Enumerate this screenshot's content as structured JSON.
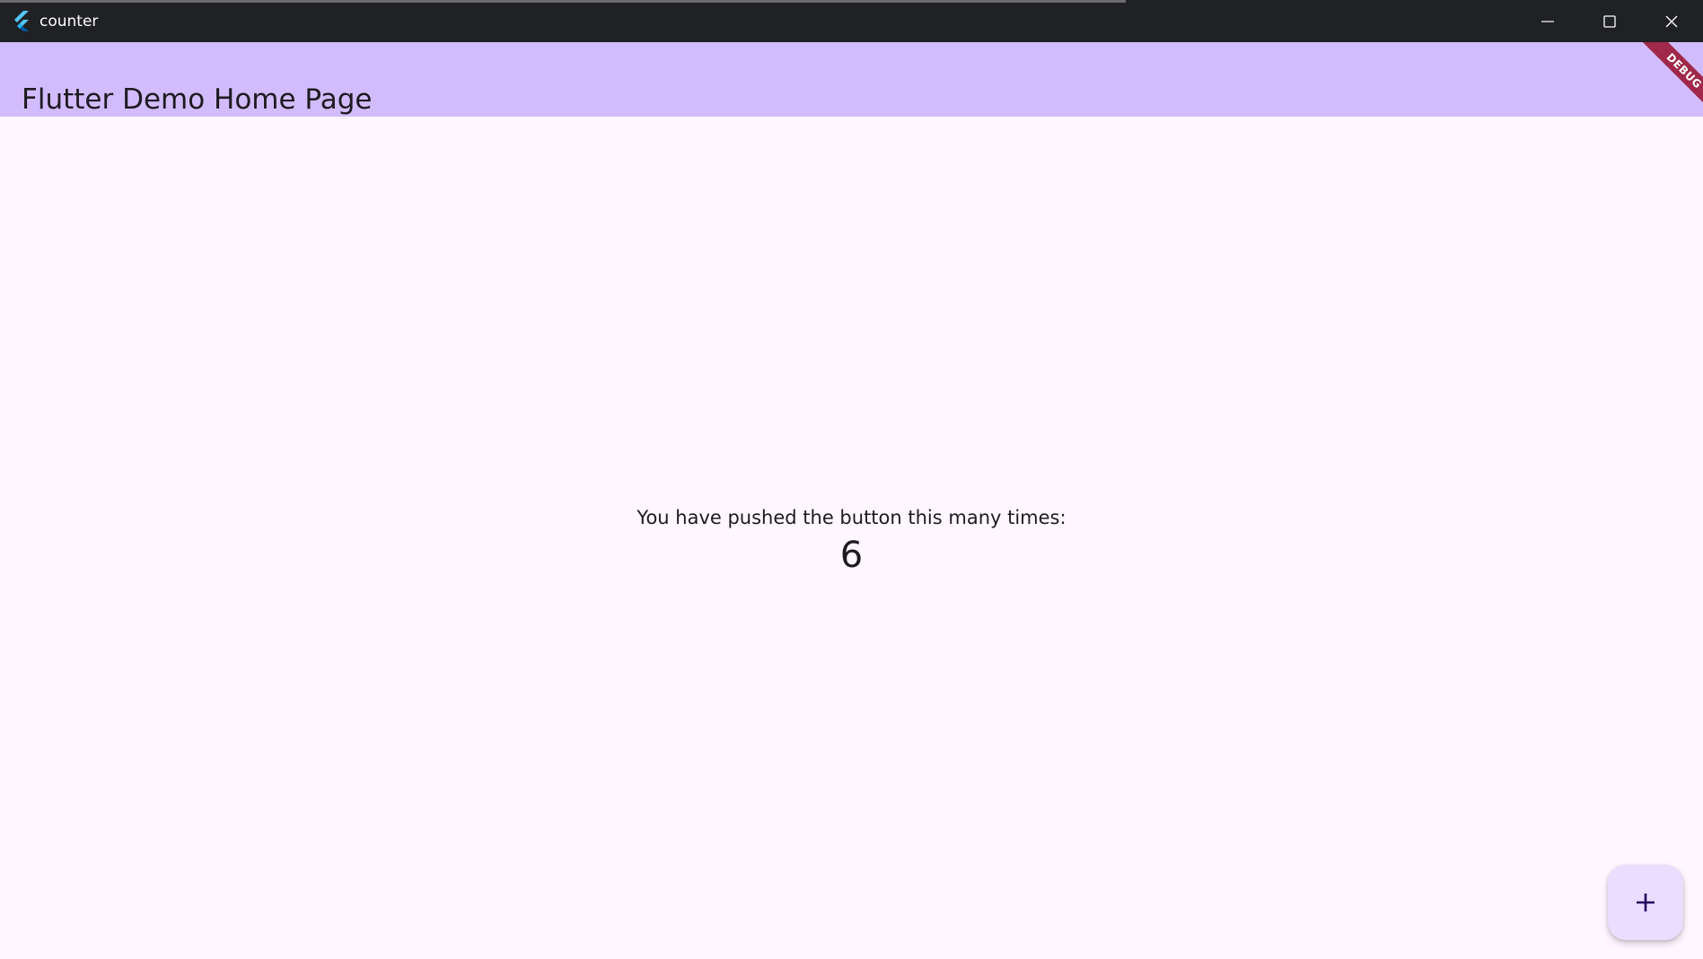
{
  "window": {
    "title": "counter",
    "icon": "flutter-logo-icon",
    "controls": {
      "minimize": "minimize-icon",
      "maximize": "maximize-icon",
      "close": "close-icon"
    }
  },
  "appbar": {
    "title": "Flutter Demo Home Page",
    "color": "#d3bcfd"
  },
  "debug_banner": {
    "label": "DEBUG",
    "color": "#a0284a"
  },
  "body": {
    "label": "You have pushed the button this many times:",
    "counter": "6"
  },
  "fab": {
    "icon": "plus-icon",
    "color": "#ebddff"
  }
}
